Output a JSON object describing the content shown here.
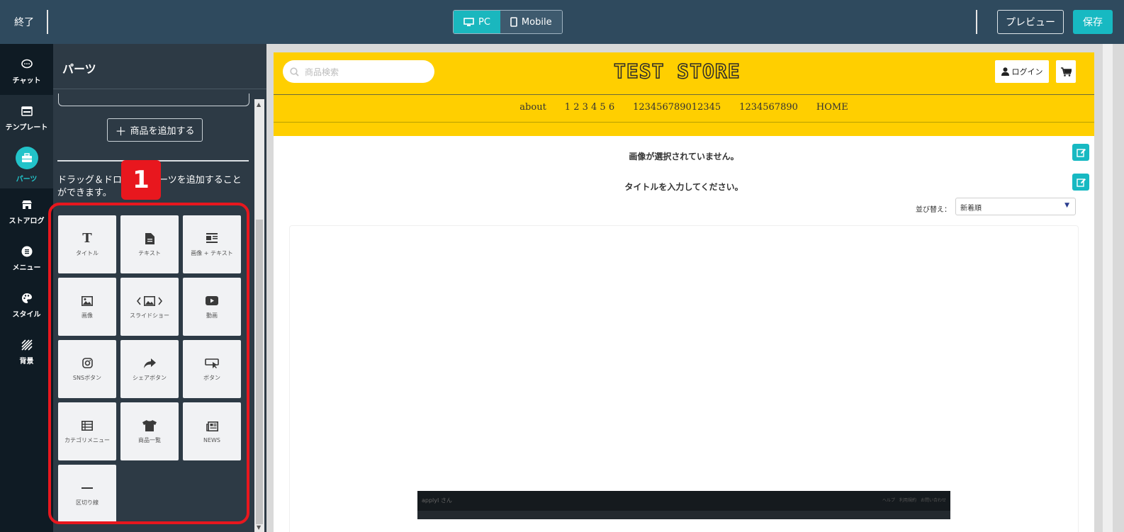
{
  "topbar": {
    "exit_label": "終了",
    "view_pc_label": "PC",
    "view_mobile_label": "Mobile",
    "preview_label": "プレビュー",
    "save_label": "保存"
  },
  "rail": {
    "items": [
      {
        "label": "チャット",
        "icon": "chat-icon"
      },
      {
        "label": "テンプレート",
        "icon": "template-icon"
      },
      {
        "label": "パーツ",
        "icon": "toolbox-icon"
      },
      {
        "label": "ストアログ",
        "icon": "store-icon"
      },
      {
        "label": "メニュー",
        "icon": "menu-icon"
      },
      {
        "label": "スタイル",
        "icon": "palette-icon"
      },
      {
        "label": "背景",
        "icon": "stripes-icon"
      }
    ]
  },
  "panel": {
    "title": "パーツ",
    "add_product_label": "商品を追加する",
    "description": "ドラッグ＆ドロップでパーツを追加することができます。",
    "badge_number": "1",
    "tiles": [
      {
        "label": "タイトル",
        "icon": "title-icon"
      },
      {
        "label": "テキスト",
        "icon": "text-file-icon"
      },
      {
        "label": "画像 + テキスト",
        "icon": "image-text-icon"
      },
      {
        "label": "画像",
        "icon": "image-icon"
      },
      {
        "label": "スライドショー",
        "icon": "slideshow-icon"
      },
      {
        "label": "動画",
        "icon": "video-icon"
      },
      {
        "label": "SNSボタン",
        "icon": "instagram-icon"
      },
      {
        "label": "シェアボタン",
        "icon": "share-icon"
      },
      {
        "label": "ボタン",
        "icon": "button-icon"
      },
      {
        "label": "カテゴリメニュー",
        "icon": "category-list-icon"
      },
      {
        "label": "商品一覧",
        "icon": "tshirt-icon"
      },
      {
        "label": "NEWS",
        "icon": "news-icon"
      },
      {
        "label": "区切り線",
        "icon": "divider-icon"
      }
    ]
  },
  "store": {
    "search_placeholder": "商品検索",
    "title": "TEST STORE",
    "login_label": "ログイン",
    "nav": [
      "about",
      "1 2 3 4 5 6",
      "123456789012345",
      "1234567890",
      "HOME"
    ],
    "no_image_message": "画像が選択されていません。",
    "title_prompt": "タイトルを入力してください。",
    "sort_label": "並び替え：",
    "sort_value": "新着順",
    "footer_user": "applyI さん",
    "footer_right": "ヘルプ　利用規約　お問い合わせ"
  },
  "colors": {
    "accent": "#17b9c2",
    "header_yellow": "#ffcf00",
    "topbar": "#2f4a5e",
    "highlight_red": "#e8171e"
  }
}
